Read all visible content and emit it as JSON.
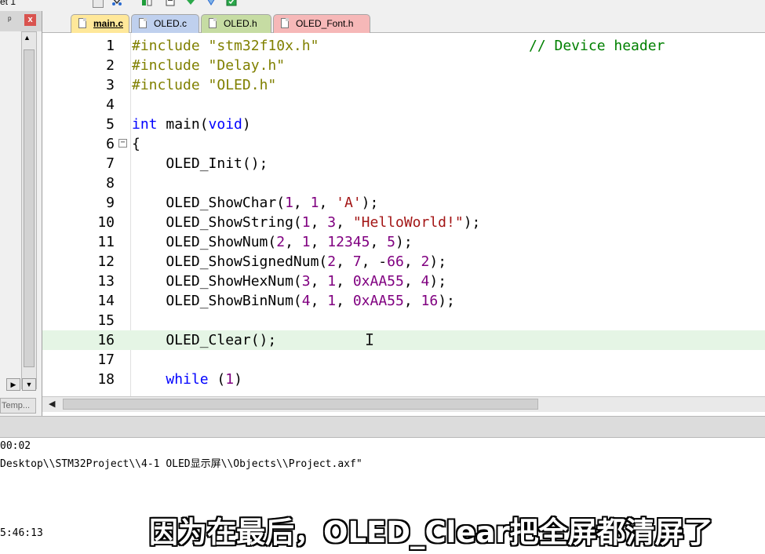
{
  "toolbar": {
    "target_label": "et 1"
  },
  "left_panel": {
    "close_glyph": "x",
    "pin_glyph": "📌",
    "templates_tab": "Temp...",
    "scroll_up": "▲",
    "scroll_down": "▼",
    "btn_right": "▶",
    "btn_down": "▼"
  },
  "tabs": [
    {
      "label": "main.c",
      "active": true,
      "color": "#ffe89a"
    },
    {
      "label": "OLED.c",
      "active": false,
      "color": "#bfd0ee"
    },
    {
      "label": "OLED.h",
      "active": false,
      "color": "#c6dca3"
    },
    {
      "label": "OLED_Font.h",
      "active": false,
      "color": "#f6b8b8"
    }
  ],
  "editor": {
    "highlight_color": "#e5f5e5",
    "line_numbers": [
      "1",
      "2",
      "3",
      "4",
      "5",
      "6",
      "7",
      "8",
      "9",
      "10",
      "11",
      "12",
      "13",
      "14",
      "15",
      "16",
      "17",
      "18"
    ],
    "lines": [
      "#include \"stm32f10x.h\"",
      "#include \"Delay.h\"",
      "#include \"OLED.h\"",
      "",
      "int main(void)",
      "{",
      "    OLED_Init();",
      "",
      "    OLED_ShowChar(1, 1, 'A');",
      "    OLED_ShowString(1, 3, \"HelloWorld!\");",
      "    OLED_ShowNum(2, 1, 12345, 5);",
      "    OLED_ShowSignedNum(2, 7, -66, 2);",
      "    OLED_ShowHexNum(3, 1, 0xAA55, 4);",
      "    OLED_ShowBinNum(4, 1, 0xAA55, 16);",
      "",
      "    OLED_Clear();",
      "",
      "    while (1)"
    ],
    "comment_line1": "// Device header",
    "fold_glyph": "−",
    "ibeam": "I"
  },
  "output": {
    "line1": "00:02",
    "line2": "Desktop\\\\STM32Project\\\\4-1 OLED显示屏\\\\Objects\\\\Project.axf\"",
    "line3": "5:46:13"
  },
  "subtitle": "因为在最后，OLED_Clear把全屏都清屏了"
}
